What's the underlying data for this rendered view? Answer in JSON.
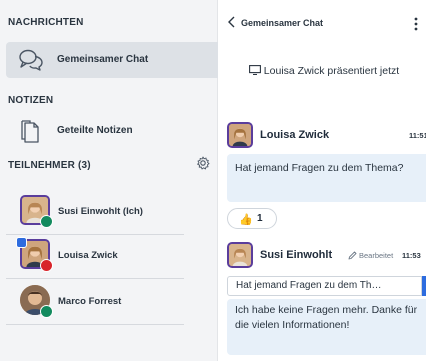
{
  "sidebar": {
    "messages_section": "NACHRICHTEN",
    "chat_item": "Gemeinsamer Chat",
    "notes_section": "NOTIZEN",
    "notes_item": "Geteilte Notizen",
    "participants_section": "TEILNEHMER (3)",
    "participants": [
      {
        "name": "Susi Einwohlt (Ich)",
        "status": "green"
      },
      {
        "name": "Louisa Zwick",
        "status": "red"
      },
      {
        "name": "Marco Forrest",
        "status": "green"
      }
    ]
  },
  "chat": {
    "title": "Gemeinsamer Chat",
    "presenting": "Louisa Zwick präsentiert jetzt",
    "messages": [
      {
        "author": "Louisa Zwick",
        "time": "11:51",
        "text": "Hat jemand Fragen zu dem Thema?",
        "reaction": {
          "emoji": "👍",
          "count": "1"
        }
      },
      {
        "author": "Susi Einwohlt",
        "edited": "Bearbeitet",
        "time": "11:53",
        "quote": "Hat jemand Fragen zu dem Th…",
        "text": "Ich habe keine Fragen mehr. Danke für die vielen Informationen!"
      }
    ]
  },
  "colors": {
    "accent": "#5a3d9c",
    "online": "#128a5e",
    "busy": "#d8232a",
    "bubble": "#e7f0f9",
    "link": "#2d6cdf"
  }
}
